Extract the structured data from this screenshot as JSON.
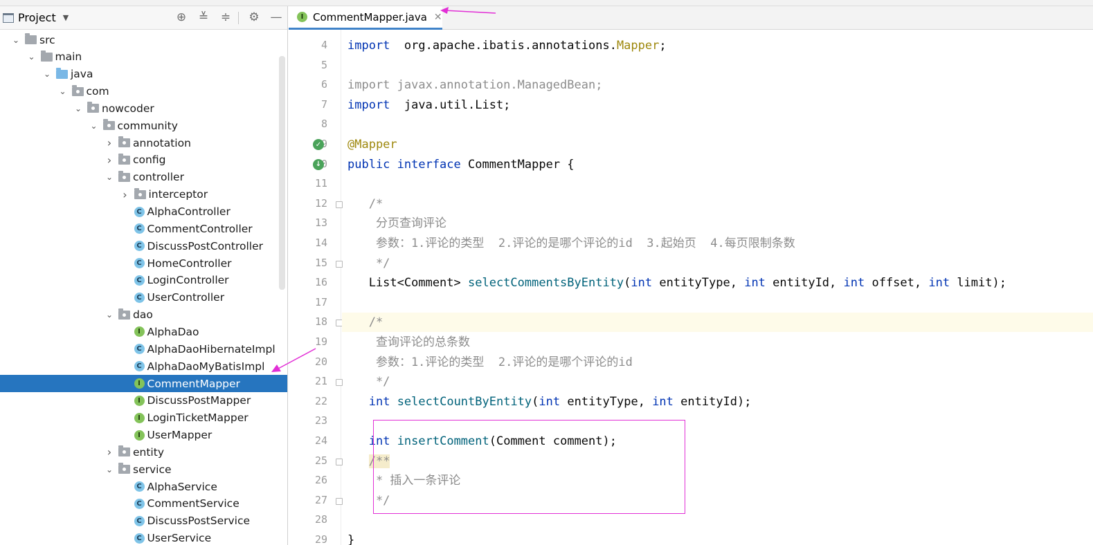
{
  "project_panel": {
    "title": "Project",
    "tree": [
      {
        "label": "src",
        "depth": 0,
        "type": "folder",
        "state": "open"
      },
      {
        "label": "main",
        "depth": 1,
        "type": "folder",
        "state": "open"
      },
      {
        "label": "java",
        "depth": 2,
        "type": "folder-blue",
        "state": "open"
      },
      {
        "label": "com",
        "depth": 3,
        "type": "package",
        "state": "open"
      },
      {
        "label": "nowcoder",
        "depth": 4,
        "type": "package",
        "state": "open"
      },
      {
        "label": "community",
        "depth": 5,
        "type": "package",
        "state": "open"
      },
      {
        "label": "annotation",
        "depth": 6,
        "type": "package",
        "state": "closed"
      },
      {
        "label": "config",
        "depth": 6,
        "type": "package",
        "state": "closed"
      },
      {
        "label": "controller",
        "depth": 6,
        "type": "package",
        "state": "open"
      },
      {
        "label": "interceptor",
        "depth": 7,
        "type": "package",
        "state": "closed"
      },
      {
        "label": "AlphaController",
        "depth": 7,
        "type": "class"
      },
      {
        "label": "CommentController",
        "depth": 7,
        "type": "class"
      },
      {
        "label": "DiscussPostController",
        "depth": 7,
        "type": "class"
      },
      {
        "label": "HomeController",
        "depth": 7,
        "type": "class"
      },
      {
        "label": "LoginController",
        "depth": 7,
        "type": "class"
      },
      {
        "label": "UserController",
        "depth": 7,
        "type": "class"
      },
      {
        "label": "dao",
        "depth": 6,
        "type": "package",
        "state": "open"
      },
      {
        "label": "AlphaDao",
        "depth": 7,
        "type": "interface"
      },
      {
        "label": "AlphaDaoHibernateImpl",
        "depth": 7,
        "type": "class"
      },
      {
        "label": "AlphaDaoMyBatisImpl",
        "depth": 7,
        "type": "class"
      },
      {
        "label": "CommentMapper",
        "depth": 7,
        "type": "interface",
        "selected": true
      },
      {
        "label": "DiscussPostMapper",
        "depth": 7,
        "type": "interface"
      },
      {
        "label": "LoginTicketMapper",
        "depth": 7,
        "type": "interface"
      },
      {
        "label": "UserMapper",
        "depth": 7,
        "type": "interface"
      },
      {
        "label": "entity",
        "depth": 6,
        "type": "package",
        "state": "closed"
      },
      {
        "label": "service",
        "depth": 6,
        "type": "package",
        "state": "open"
      },
      {
        "label": "AlphaService",
        "depth": 7,
        "type": "class"
      },
      {
        "label": "CommentService",
        "depth": 7,
        "type": "class"
      },
      {
        "label": "DiscussPostService",
        "depth": 7,
        "type": "class"
      },
      {
        "label": "UserService",
        "depth": 7,
        "type": "class"
      }
    ]
  },
  "editor": {
    "tab": {
      "label": "CommentMapper.java",
      "icon": "interface-icon"
    },
    "lines": [
      {
        "n": "4",
        "tokens": [
          [
            "kw",
            "import"
          ],
          [
            "",
            "  org.apache.ibatis.annotations."
          ],
          [
            "ann",
            "Mapper"
          ],
          [
            "",
            ";"
          ]
        ]
      },
      {
        "n": "5",
        "tokens": []
      },
      {
        "n": "6",
        "tokens": [
          [
            "gray",
            "import javax.annotation.ManagedBean;"
          ]
        ]
      },
      {
        "n": "7",
        "tokens": [
          [
            "kw",
            "import"
          ],
          [
            "",
            "  java.util.List;"
          ]
        ]
      },
      {
        "n": "8",
        "tokens": []
      },
      {
        "n": "9",
        "tokens": [
          [
            "ann",
            "@Mapper"
          ]
        ]
      },
      {
        "n": "10",
        "tokens": [
          [
            "kw",
            "public interface"
          ],
          [
            "",
            " CommentMapper {"
          ]
        ]
      },
      {
        "n": "11",
        "tokens": []
      },
      {
        "n": "12",
        "tokens": [
          [
            "cmt",
            "   /*"
          ]
        ]
      },
      {
        "n": "13",
        "tokens": [
          [
            "cmt",
            "    分页查询评论"
          ]
        ]
      },
      {
        "n": "14",
        "tokens": [
          [
            "cmt",
            "    参数：1.评论的类型  2.评论的是哪个评论的id  3.起始页  4.每页限制条数"
          ]
        ]
      },
      {
        "n": "15",
        "tokens": [
          [
            "cmt",
            "    */"
          ]
        ]
      },
      {
        "n": "16",
        "tokens": [
          [
            "",
            "   List<Comment> "
          ],
          [
            "fn",
            "selectCommentsByEntity"
          ],
          [
            "",
            "("
          ],
          [
            "kw",
            "int"
          ],
          [
            "",
            " entityType, "
          ],
          [
            "kw",
            "int"
          ],
          [
            "",
            " entityId, "
          ],
          [
            "kw",
            "int"
          ],
          [
            "",
            " offset, "
          ],
          [
            "kw",
            "int"
          ],
          [
            "",
            " limit);"
          ]
        ]
      },
      {
        "n": "17",
        "tokens": []
      },
      {
        "n": "18",
        "tokens": [
          [
            "cmt",
            "   /*"
          ]
        ],
        "current": true
      },
      {
        "n": "19",
        "tokens": [
          [
            "cmt",
            "    查询评论的总条数"
          ]
        ]
      },
      {
        "n": "20",
        "tokens": [
          [
            "cmt",
            "    参数：1.评论的类型  2.评论的是哪个评论的id"
          ]
        ]
      },
      {
        "n": "21",
        "tokens": [
          [
            "cmt",
            "    */"
          ]
        ]
      },
      {
        "n": "22",
        "tokens": [
          [
            "",
            "   "
          ],
          [
            "kw",
            "int"
          ],
          [
            "",
            " "
          ],
          [
            "fn",
            "selectCountByEntity"
          ],
          [
            "",
            "("
          ],
          [
            "kw",
            "int"
          ],
          [
            "",
            " entityType, "
          ],
          [
            "kw",
            "int"
          ],
          [
            "",
            " entityId);"
          ]
        ]
      },
      {
        "n": "23",
        "tokens": []
      },
      {
        "n": "24",
        "tokens": [
          [
            "",
            "   "
          ],
          [
            "kw",
            "int"
          ],
          [
            "",
            " "
          ],
          [
            "fn",
            "insertComment"
          ],
          [
            "",
            "(Comment comment);"
          ]
        ]
      },
      {
        "n": "25",
        "tokens": [
          [
            "",
            "   "
          ],
          [
            "cmt hl-doc",
            "/**"
          ]
        ]
      },
      {
        "n": "26",
        "tokens": [
          [
            "cmt",
            "    * 插入一条评论"
          ]
        ]
      },
      {
        "n": "27",
        "tokens": [
          [
            "cmt",
            "    */"
          ]
        ]
      },
      {
        "n": "28",
        "tokens": []
      },
      {
        "n": "29",
        "tokens": [
          [
            "",
            "}"
          ]
        ]
      }
    ]
  },
  "colors": {
    "selection": "#2675bf",
    "keyword": "#0033b3",
    "annotation": "#9e880d",
    "method": "#00627a",
    "comment": "#8c8c8c",
    "highlight_box": "#e22fd6"
  }
}
